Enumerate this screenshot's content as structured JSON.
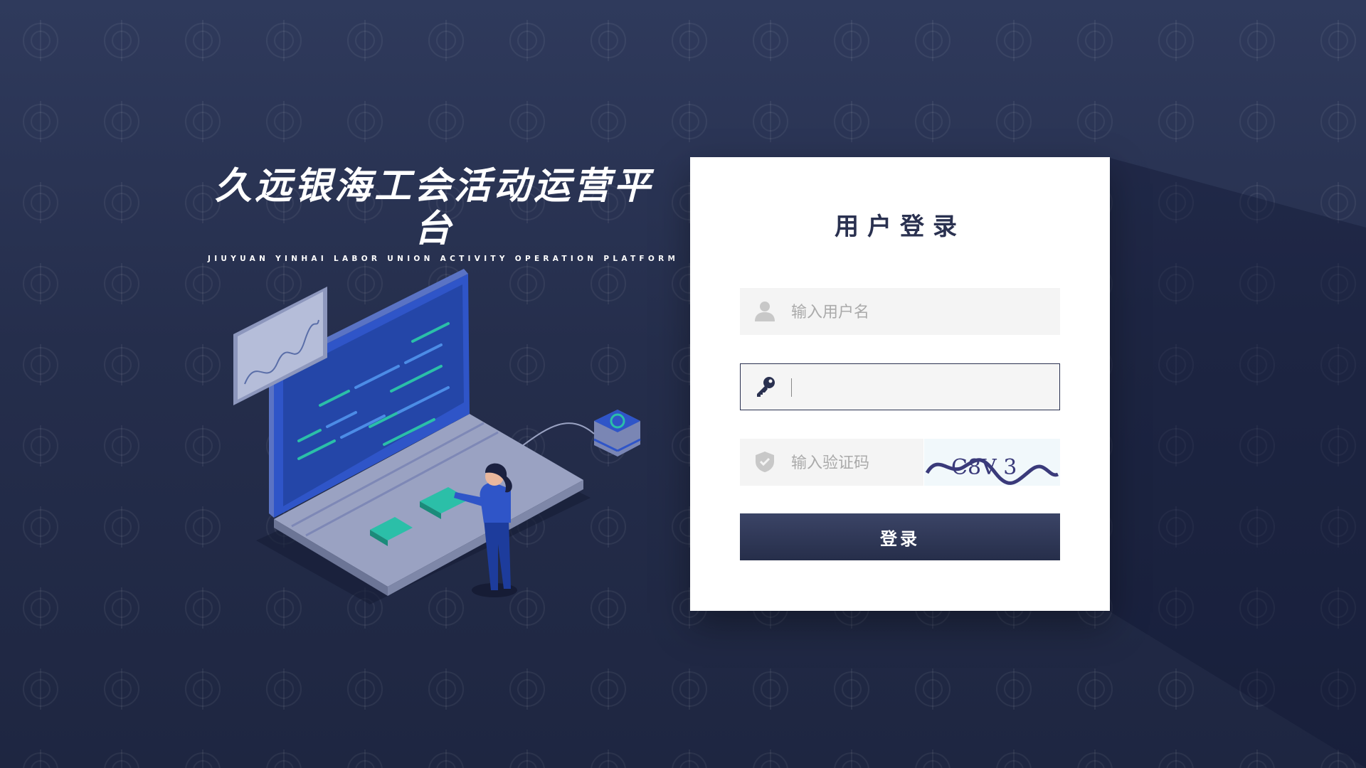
{
  "brand": {
    "title": "久远银海工会活动运营平台",
    "subtitle": "JIUYUAN YINHAI LABOR UNION ACTIVITY OPERATION PLATFORM"
  },
  "login": {
    "title": "用户登录",
    "username": {
      "placeholder": "输入用户名",
      "value": "",
      "icon": "user-icon"
    },
    "password": {
      "placeholder": "",
      "value": "",
      "icon": "key-icon"
    },
    "captcha": {
      "placeholder": "输入验证码",
      "value": "",
      "icon": "shield-icon",
      "code": "C8V 3"
    },
    "submit_label": "登录"
  },
  "colors": {
    "background": "#252e4c",
    "card": "#ffffff",
    "accent": "#2a3150",
    "field": "#f4f4f4",
    "illustration_blue": "#2f55c8",
    "illustration_teal": "#2bbfa8"
  }
}
